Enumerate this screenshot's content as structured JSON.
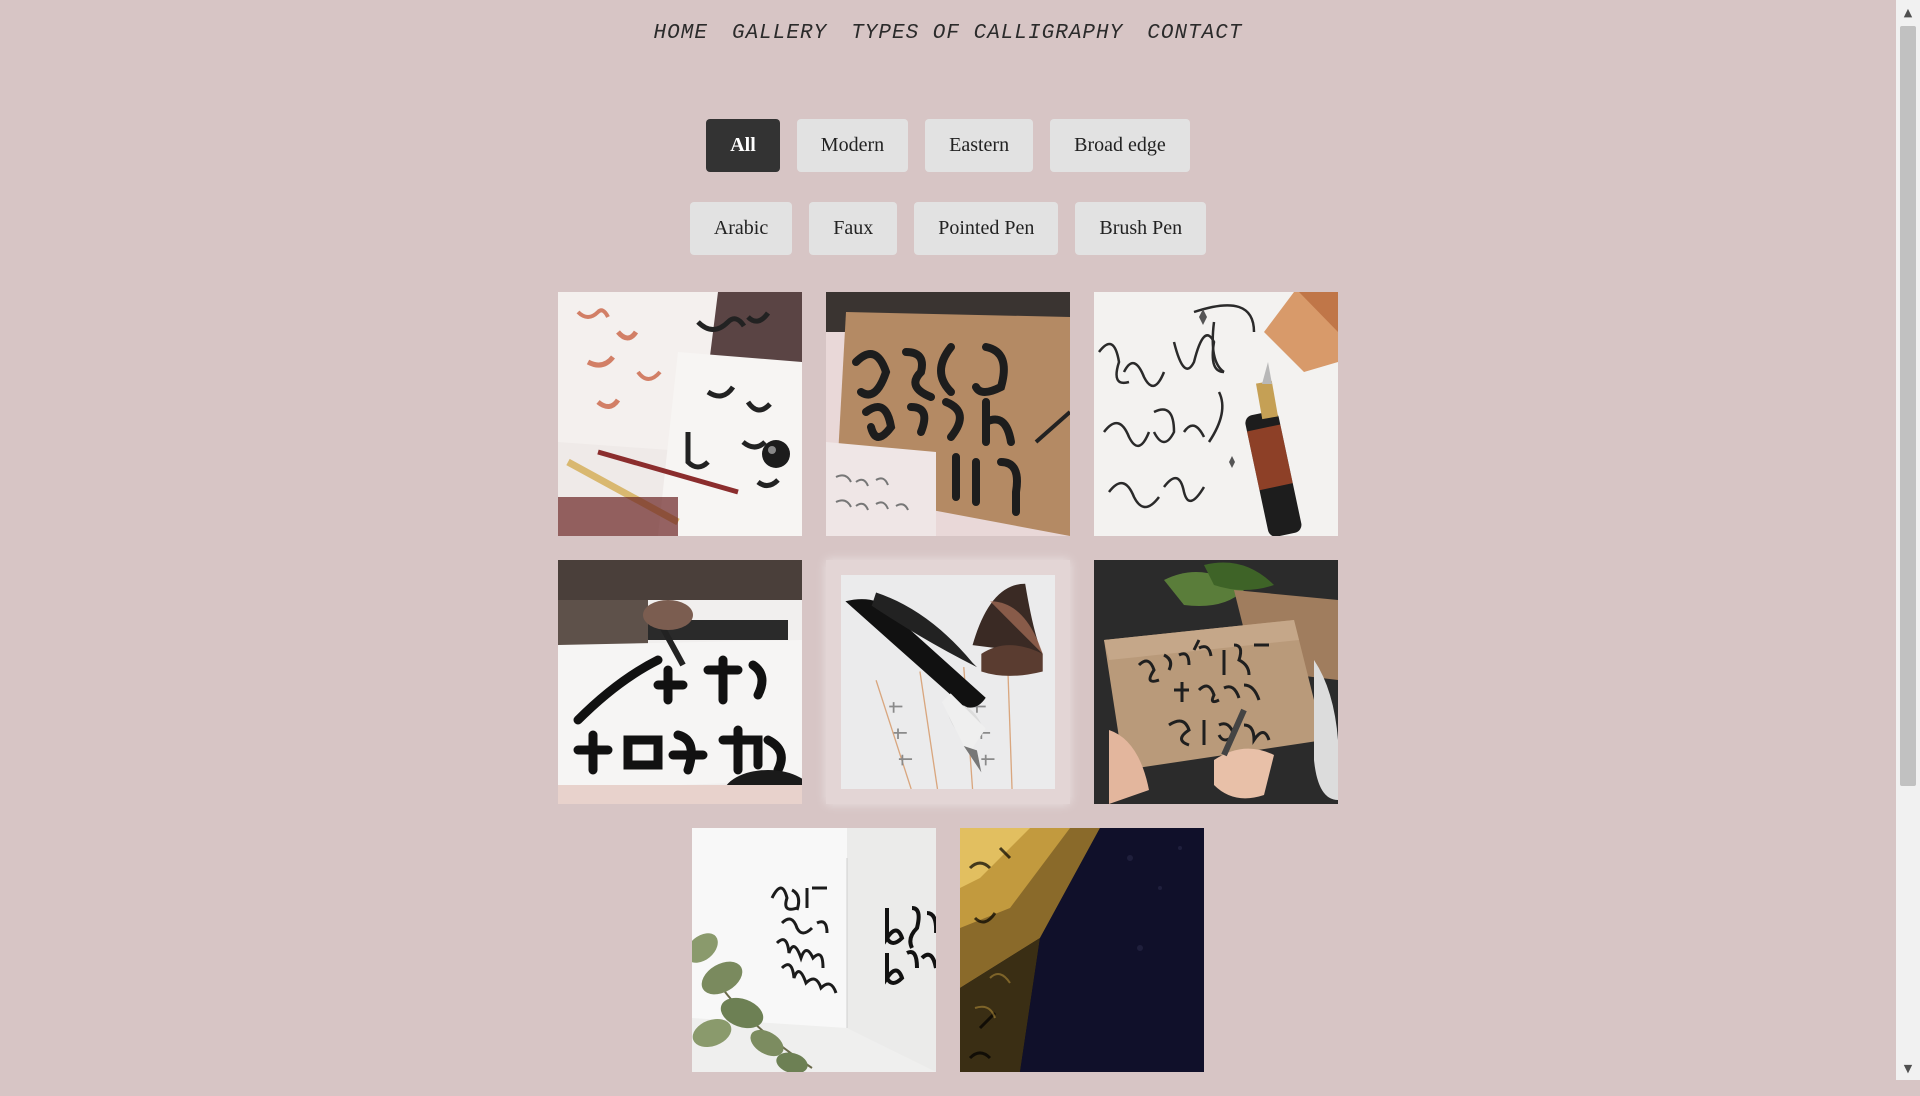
{
  "nav": {
    "items": [
      {
        "label": "HOME"
      },
      {
        "label": "GALLERY"
      },
      {
        "label": "TYPES OF CALLIGRAPHY"
      },
      {
        "label": "CONTACT"
      }
    ]
  },
  "filters": {
    "active": "All",
    "row1": [
      {
        "label": "All"
      },
      {
        "label": "Modern"
      },
      {
        "label": "Eastern"
      },
      {
        "label": "Broad edge"
      }
    ],
    "row2": [
      {
        "label": "Arabic"
      },
      {
        "label": "Faux"
      },
      {
        "label": "Pointed Pen"
      },
      {
        "label": "Brush Pen"
      }
    ]
  },
  "gallery": {
    "images": [
      {
        "name": "arabic-calligraphy-photo"
      },
      {
        "name": "broad-edge-alphabet-photo"
      },
      {
        "name": "pointed-pen-love-what-you-are-photo"
      },
      {
        "name": "eastern-brush-writing-photo"
      },
      {
        "name": "chinese-brush-pen-photo"
      },
      {
        "name": "dont-let-them-stop-you-photo"
      },
      {
        "name": "faith-can-move-mountains-photo"
      },
      {
        "name": "gold-dark-abstract-photo"
      }
    ]
  },
  "colors": {
    "background": "#d7c5c5",
    "active_button": "#333333",
    "button": "#e2e2e2"
  }
}
